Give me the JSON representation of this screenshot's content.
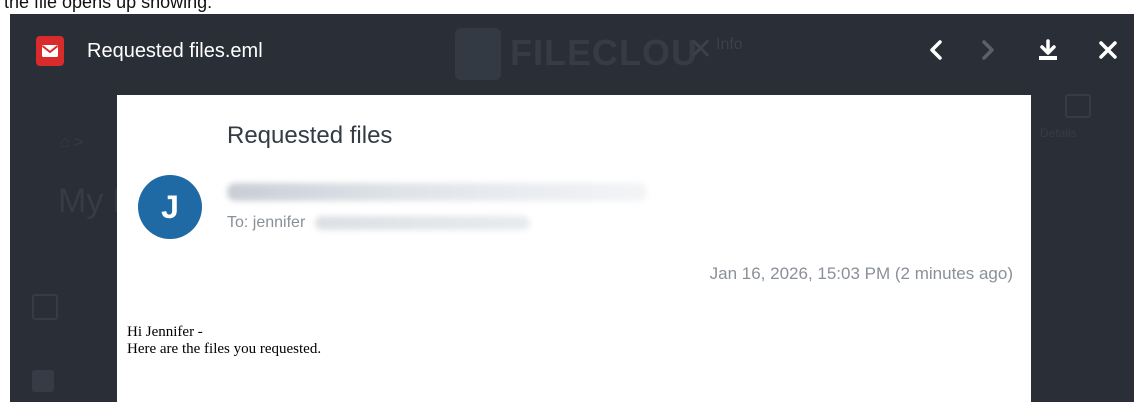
{
  "caption": "the file opens up showing:",
  "viewer": {
    "title": "Requested files.eml",
    "background_app": {
      "brand": "FILECLOU",
      "close_glyph": "✕",
      "info": "Info",
      "page_title": "My F",
      "breadcrumb": "⌂ >",
      "right_label": "Details"
    }
  },
  "email": {
    "subject": "Requested files",
    "avatar_letter": "J",
    "to_prefix": "To: jennifer",
    "date": "Jan 16, 2026, 15:03 PM (2 minutes ago)",
    "body_line1": "Hi Jennifer -",
    "body_line2": "Here are the files you requested."
  },
  "colors": {
    "overlay": "#2a2f37",
    "avatar": "#1f6aa4",
    "file_icon": "#d92b2b"
  },
  "icons": {
    "file": "envelope-file-icon",
    "prev": "chevron-left-icon",
    "next": "chevron-right-icon",
    "download": "download-icon",
    "close": "close-icon"
  }
}
